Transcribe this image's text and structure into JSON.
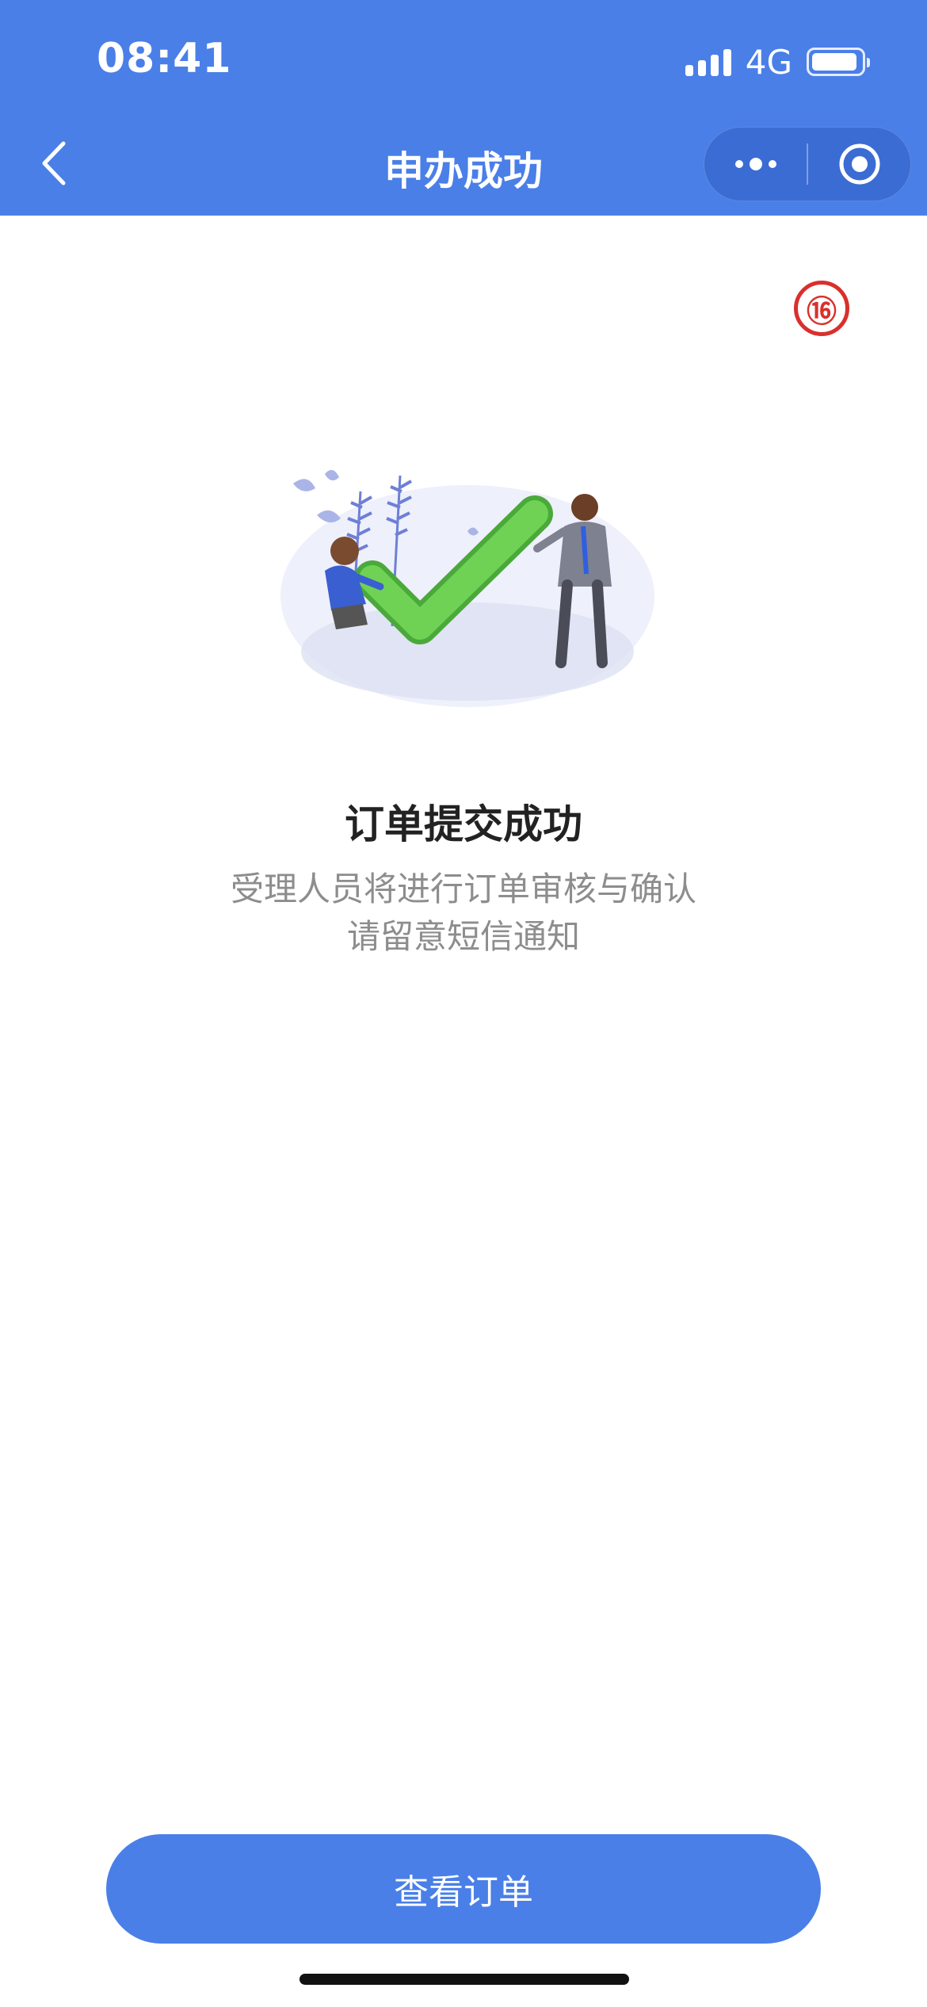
{
  "status_bar": {
    "time": "08:41",
    "network": "4G",
    "battery_level": 0.9
  },
  "nav": {
    "title": "申办成功",
    "back_icon": "chevron-left-icon",
    "more_icon": "more-dots-icon",
    "close_icon": "record-circle-icon"
  },
  "annotation": {
    "mark": "⑯"
  },
  "result": {
    "illustration_icon": "success-check-illustration",
    "title": "订单提交成功",
    "desc_line1": "受理人员将进行订单审核与确认",
    "desc_line2": "请留意短信通知"
  },
  "footer": {
    "view_order_label": "查看订单"
  },
  "colors": {
    "primary": "#4a7fe8",
    "check_green": "#5ec544",
    "mark_red": "#d9302c"
  }
}
